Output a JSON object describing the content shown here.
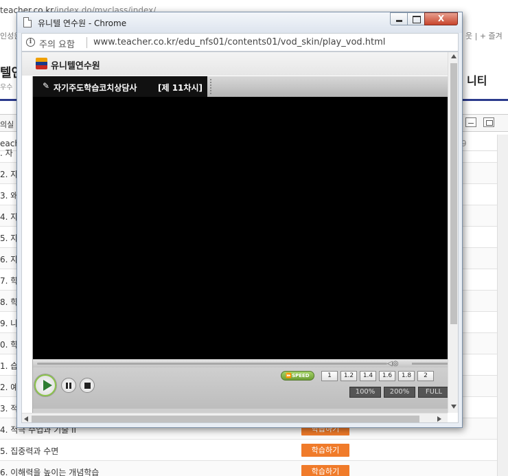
{
  "background_page": {
    "url_dark": "teacher.co.kr",
    "url_light": "/index.do/myclass/index/",
    "top_left_text": "인성원",
    "top_right_text": "웃 | + 즐겨",
    "logo_text": "텔연",
    "logo_sub": "우수",
    "nav_item": "니티",
    "classroom_tab": "의실",
    "subheader_left": "each",
    "subheader_right": "9",
    "lessons": [
      {
        "title": ". 자",
        "button": ""
      },
      {
        "title": "2. 자",
        "button": ""
      },
      {
        "title": "3. 왜",
        "button": ""
      },
      {
        "title": "4. 자",
        "button": ""
      },
      {
        "title": "5. 자",
        "button": ""
      },
      {
        "title": "6. 자",
        "button": ""
      },
      {
        "title": "7. 학",
        "button": ""
      },
      {
        "title": "8. 학",
        "button": ""
      },
      {
        "title": "9. 나",
        "button": ""
      },
      {
        "title": "0. 학",
        "button": ""
      },
      {
        "title": "1. 습",
        "button": ""
      },
      {
        "title": "2. 예",
        "button": ""
      },
      {
        "title": "3. 적",
        "button": ""
      },
      {
        "title": "4. 적극 수업과 기술 II",
        "button": "학습하기"
      },
      {
        "title": "5. 집중력과 수면",
        "button": "학습하기"
      },
      {
        "title": "6. 이해력을 높이는 개념학습",
        "button": "학습하기"
      }
    ]
  },
  "window": {
    "title": "유니텔 연수원 - Chrome",
    "close_glyph": "X",
    "security_label": "주의 요함",
    "address": "www.teacher.co.kr/edu_nfs01/contents01/vod_skin/play_vod.html",
    "info_glyph": "i"
  },
  "site": {
    "logo_text": "유니텔연수원"
  },
  "player": {
    "pencil_glyph": "✎",
    "course_title": "자기주도학습코치상담사",
    "lesson_number": "[제 11차시]",
    "volume_glyph": "◁◎",
    "speed_label": "⏩SPEED",
    "speed_options": [
      "1",
      "1.2",
      "1.4",
      "1.6",
      "1.8",
      "2"
    ],
    "zoom_options": [
      "100%",
      "200%",
      "FULL"
    ]
  }
}
